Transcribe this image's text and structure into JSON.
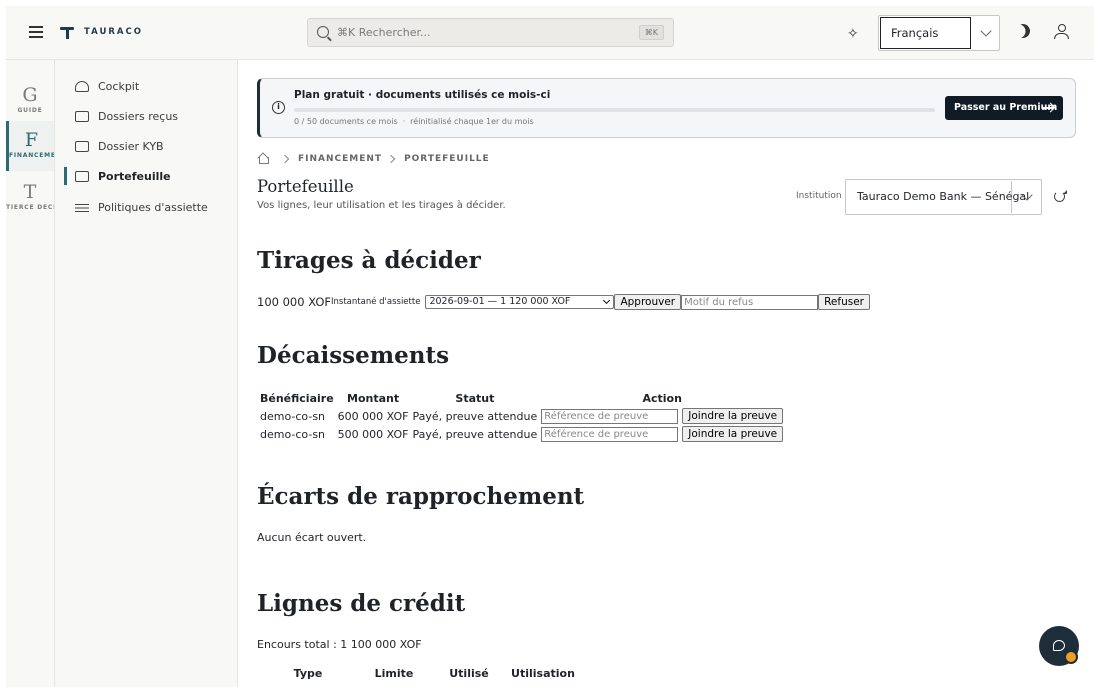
{
  "header": {
    "brand": "TAURACO",
    "search_placeholder": "⌘K Rechercher...",
    "search_shortcut": "⌘K",
    "language": "Français"
  },
  "rail": [
    {
      "letter": "G",
      "label": "GUIDE"
    },
    {
      "letter": "F",
      "label": "FINANCEMENT"
    },
    {
      "letter": "T",
      "label": "TIERCE DÉCISION"
    }
  ],
  "sidebar": {
    "items": [
      {
        "label": "Cockpit",
        "icon": "gauge-icon"
      },
      {
        "label": "Dossiers reçus",
        "icon": "inbox-icon"
      },
      {
        "label": "Dossier KYB",
        "icon": "id-card-icon"
      },
      {
        "label": "Portefeuille",
        "icon": "briefcase-icon"
      },
      {
        "label": "Politiques d'assiette",
        "icon": "sliders-icon"
      }
    ]
  },
  "plan": {
    "title": "Plan gratuit · documents utilisés ce mois-ci",
    "usage_text": "0 / 50 documents ce mois",
    "reset_text": "réinitialisé chaque 1er du mois",
    "usage_fraction": 0,
    "cta": "Passer au Premium"
  },
  "breadcrumb": {
    "section": "FINANCEMENT",
    "page": "PORTEFEUILLE"
  },
  "page": {
    "title": "Portefeuille",
    "subtitle": "Vos lignes, leur utilisation et les tirages à décider.",
    "institution_label": "Institution",
    "institution": "Tauraco Demo Bank — Sénégal"
  },
  "tirages": {
    "heading": "Tirages à décider",
    "amount": "100 000 XOF",
    "snapshot_label": "Instantané d'assiette",
    "snapshot_value": "2026-09-01 — 1 120 000 XOF",
    "approve": "Approuver",
    "refusal_placeholder": "Motif du refus",
    "refuse": "Refuser"
  },
  "decaissements": {
    "heading": "Décaissements",
    "columns": [
      "Bénéficiaire",
      "Montant",
      "Statut",
      "Action"
    ],
    "rows": [
      {
        "beneficiary": "demo-co-sn",
        "amount": "600 000 XOF",
        "status": "Payé, preuve attendue"
      },
      {
        "beneficiary": "demo-co-sn",
        "amount": "500 000 XOF",
        "status": "Payé, preuve attendue"
      }
    ],
    "proof_placeholder": "Référence de preuve",
    "attach": "Joindre la preuve"
  },
  "ecarts": {
    "heading": "Écarts de rapprochement",
    "empty": "Aucun écart ouvert."
  },
  "lignes": {
    "heading": "Lignes de crédit",
    "total": "Encours total : 1 100 000 XOF",
    "columns": [
      "Type",
      "Limite",
      "Utilisé",
      "Utilisation"
    ]
  },
  "colors": {
    "accent": "#2d6b73",
    "dark": "#111b26"
  }
}
